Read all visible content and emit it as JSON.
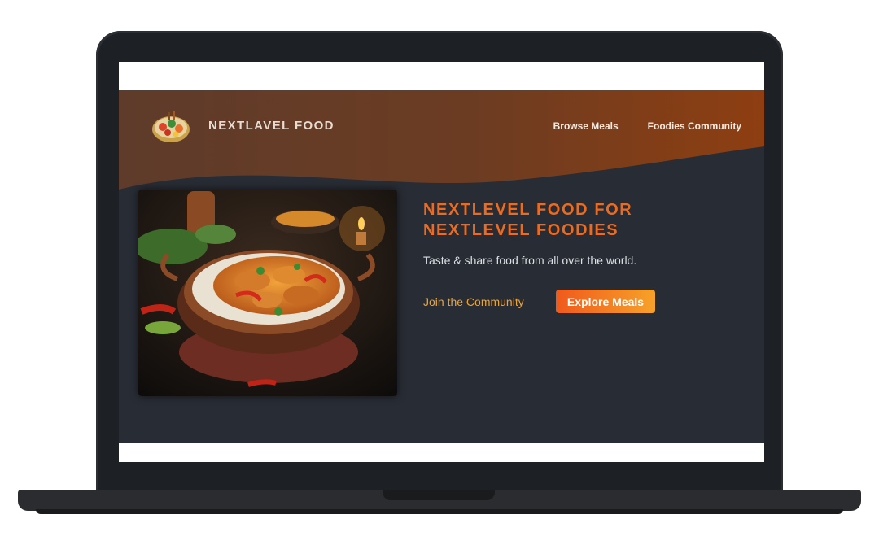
{
  "brand": {
    "name": "NEXTLAVEL FOOD"
  },
  "nav": {
    "items": [
      {
        "label": "Browse Meals"
      },
      {
        "label": "Foodies Community"
      }
    ]
  },
  "hero": {
    "title": "NEXTLEVEL FOOD FOR NEXTLEVEL FOODIES",
    "subtitle": "Taste & share food from all over the world.",
    "cta_link": "Join the Community",
    "cta_button": "Explore Meals",
    "image_icon": "curry-dish-photo"
  },
  "colors": {
    "accent_orange": "#f06a1e",
    "link_orange": "#f2a32c",
    "page_bg": "#282c34",
    "header_brown": "#7a3d1a"
  }
}
